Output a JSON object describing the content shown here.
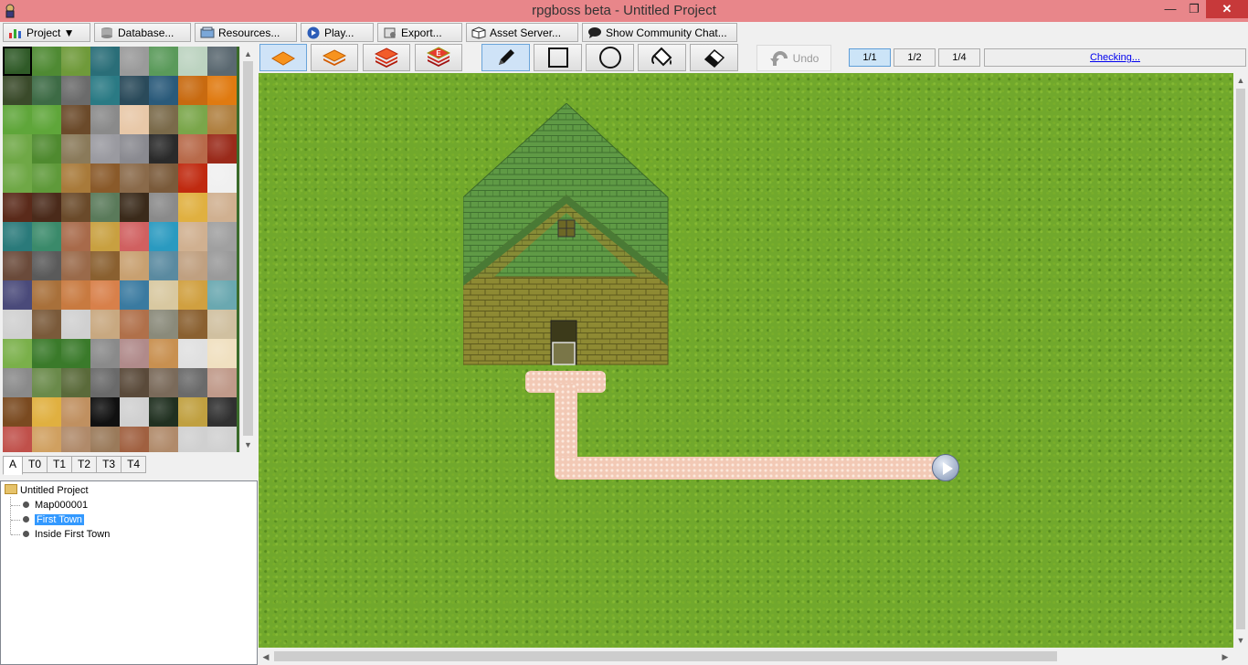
{
  "window": {
    "title": "rpgboss beta - Untitled Project",
    "min": "—",
    "max": "❐",
    "close": "✕"
  },
  "menu": {
    "project": "Project ▼",
    "database": "Database...",
    "resources": "Resources...",
    "play": "Play...",
    "export": "Export...",
    "asset_server": "Asset Server...",
    "community": "Show Community Chat..."
  },
  "toolbar": {
    "undo": "Undo",
    "zoom": [
      "1/1",
      "1/2",
      "1/4"
    ],
    "zoom_selected": "1/1",
    "status_link": "Checking...",
    "layer_icons": [
      "layer-1-icon",
      "layer-2-icon",
      "layer-3-icon",
      "event-layer-icon"
    ],
    "event_layer_letter": "E",
    "tool_icons": [
      "pencil-icon",
      "rectangle-icon",
      "ellipse-icon",
      "fill-bucket-icon",
      "eraser-icon"
    ]
  },
  "tileset": {
    "tabs": [
      "A",
      "T0",
      "T1",
      "T2",
      "T3",
      "T4"
    ],
    "active_tab": "A"
  },
  "tree": {
    "root": "Untitled Project",
    "maps": [
      "Map000001",
      "First Town",
      "Inside First Town"
    ],
    "selected": "First Town"
  },
  "colors": {
    "titlebar": "#e8868a",
    "grass": "#71a82c",
    "path": "#f2c9b5",
    "selection": "#3399ff"
  }
}
